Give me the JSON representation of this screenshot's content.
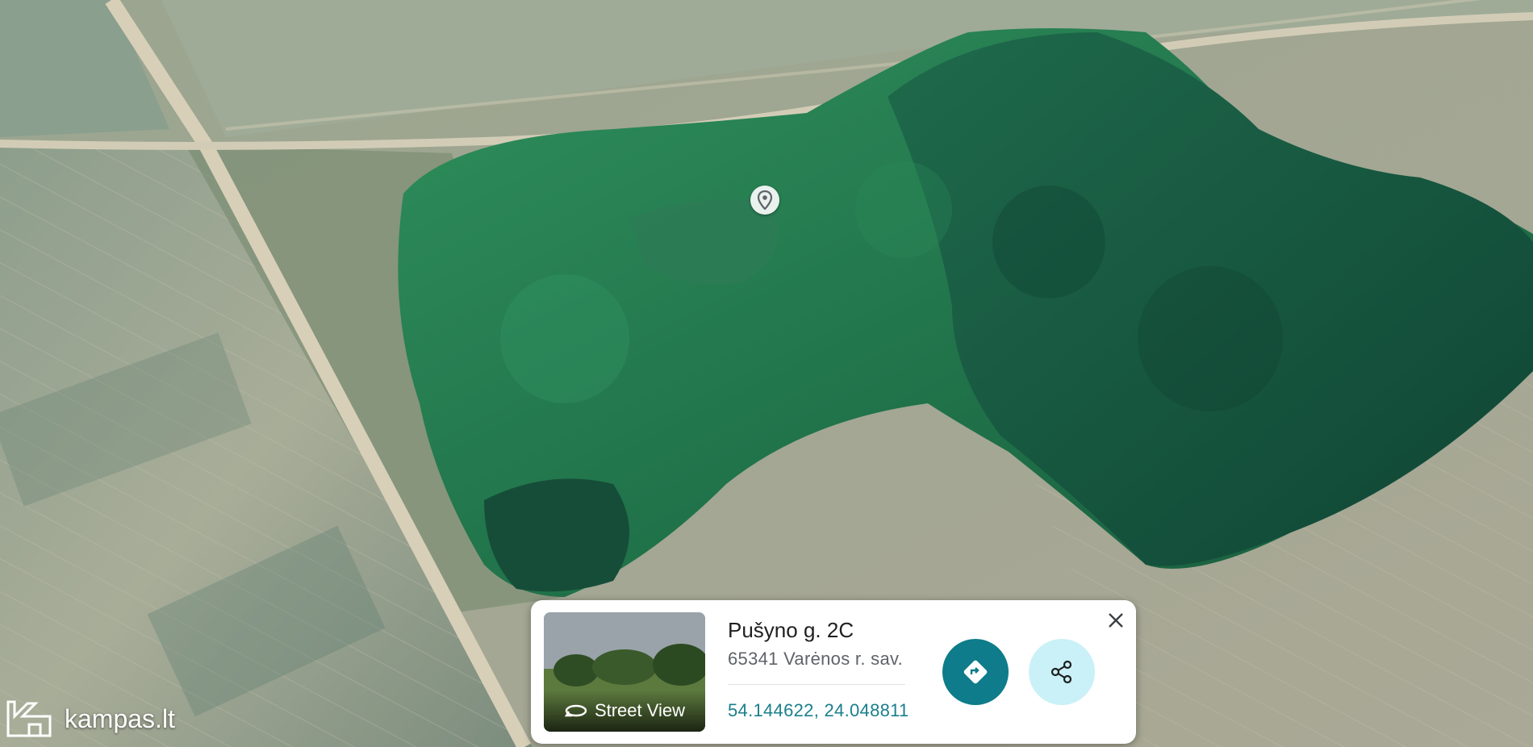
{
  "place": {
    "title": "Pušyno g. 2C",
    "address": "65341 Varėnos r. sav.",
    "coordinates": "54.144622, 24.048811"
  },
  "street_view": {
    "label": "Street View"
  },
  "watermark": {
    "text": "kampas.lt"
  },
  "icons": {
    "pin": "location-pin-icon",
    "directions": "directions-icon",
    "share": "share-icon",
    "close": "close-icon",
    "street_view": "rotate-360-icon",
    "watermark": "house-k-logo-icon"
  },
  "colors": {
    "accent": "#0e7c8a",
    "share_bg": "#c9f1f7",
    "coords_text": "#1a7f8c"
  }
}
